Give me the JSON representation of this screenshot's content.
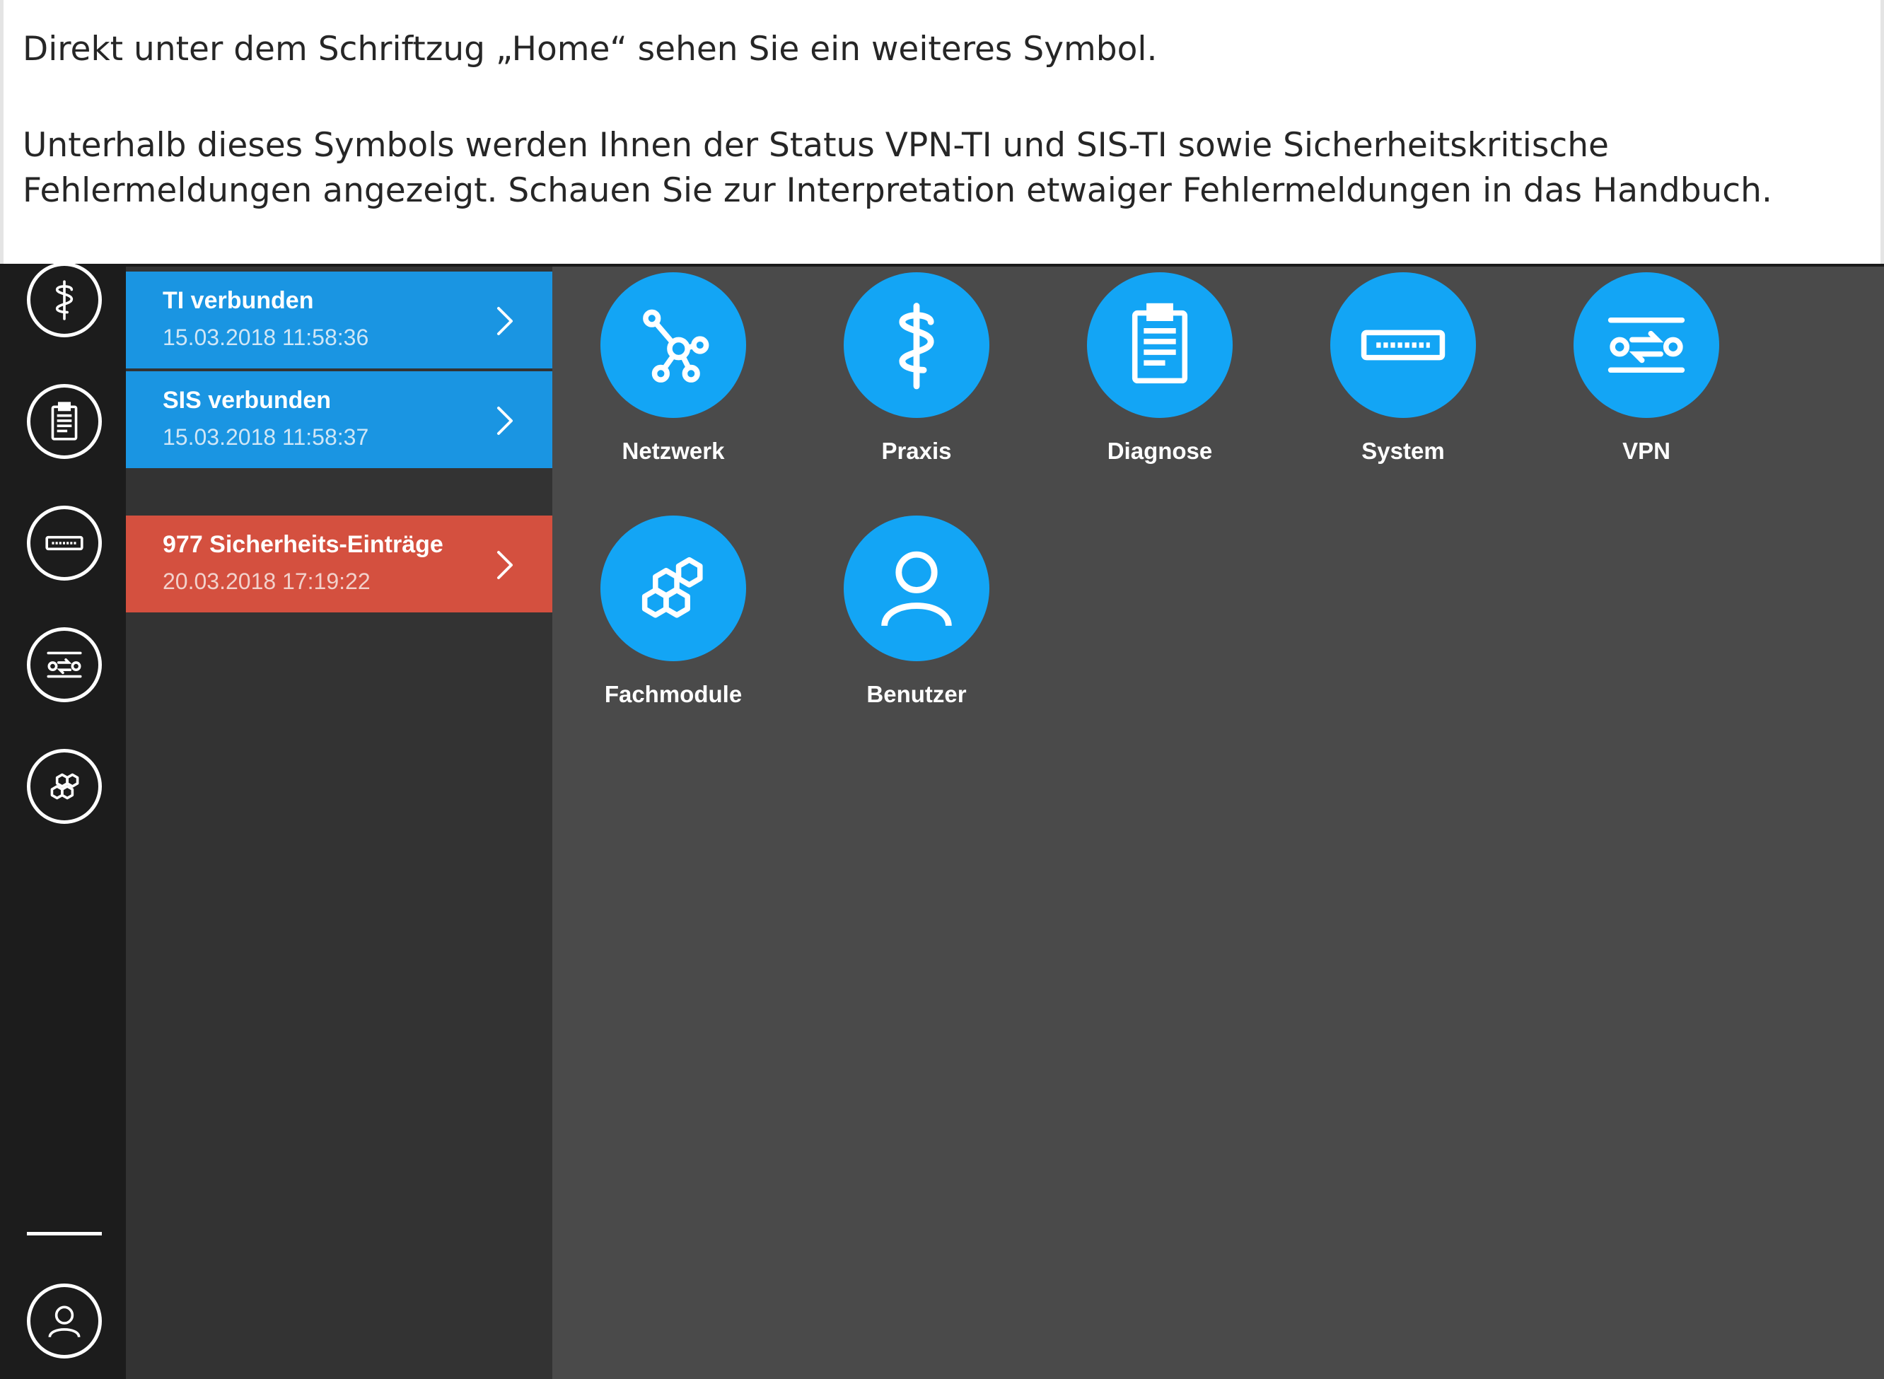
{
  "doc": {
    "paragraph1": "Direkt unter dem Schriftzug „Home“ sehen Sie ein weiteres Symbol.",
    "paragraph2": "Unterhalb dieses Symbols werden Ihnen der Status VPN-TI und SIS-TI sowie Sicherheitskritische Fehlermeldungen angezeigt. Schauen Sie zur Interpretation etwaiger Fehlermeldungen in das Handbuch."
  },
  "rail": {
    "items": [
      "caduceus-icon",
      "clipboard-icon",
      "device-icon",
      "vpn-icon",
      "modules-icon",
      "user-icon"
    ]
  },
  "status": {
    "ti": {
      "title": "TI verbunden",
      "time": "15.03.2018 11:58:36"
    },
    "sis": {
      "title": "SIS verbunden",
      "time": "15.03.2018 11:58:37"
    },
    "security": {
      "title": "977 Sicherheits-Einträge",
      "time": "20.03.2018 17:19:22"
    }
  },
  "tiles": {
    "netzwerk": "Netzwerk",
    "praxis": "Praxis",
    "diagnose": "Diagnose",
    "system": "System",
    "vpn": "VPN",
    "fachmodule": "Fachmodule",
    "benutzer": "Benutzer"
  },
  "colors": {
    "accent": "#13a5f5",
    "status_ok": "#1a95e2",
    "status_error": "#d4503f",
    "rail_bg": "#1c1c1c",
    "panel_bg": "#333333",
    "main_bg": "#4a4a4a"
  }
}
